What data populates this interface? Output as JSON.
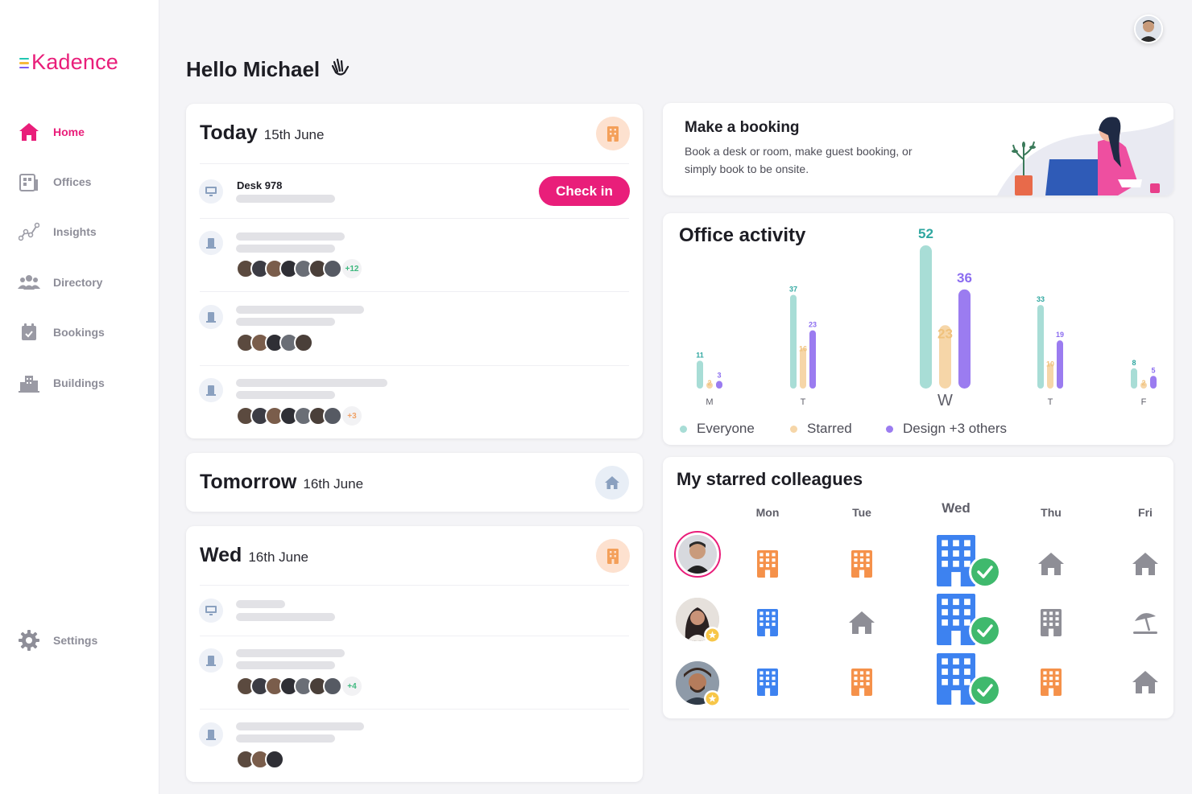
{
  "app": {
    "logo_text": "Kadence",
    "brand_color": "#e91e7a"
  },
  "sidebar": {
    "items": [
      {
        "label": "Home",
        "icon": "home-icon",
        "active": true
      },
      {
        "label": "Offices",
        "icon": "offices-icon",
        "active": false
      },
      {
        "label": "Insights",
        "icon": "insights-icon",
        "active": false
      },
      {
        "label": "Directory",
        "icon": "directory-icon",
        "active": false
      },
      {
        "label": "Bookings",
        "icon": "bookings-icon",
        "active": false
      },
      {
        "label": "Buildings",
        "icon": "buildings-icon",
        "active": false
      }
    ],
    "settings_label": "Settings"
  },
  "header": {
    "greeting": "Hello Michael",
    "greeting_icon": "waving-hand-icon"
  },
  "today": {
    "day": "Today",
    "date": "15th June",
    "location_icon": "office-building-icon",
    "desk_label": "Desk 978",
    "checkin_label": "Check in",
    "extra_counts": [
      "+12",
      "+3"
    ]
  },
  "tomorrow": {
    "day": "Tomorrow",
    "date": "16th June",
    "location_icon": "home-icon"
  },
  "wed": {
    "day": "Wed",
    "date": "16th June",
    "location_icon": "office-building-icon",
    "extra_counts": [
      "+4"
    ]
  },
  "booking": {
    "title": "Make a booking",
    "description": "Book a desk or room, make guest booking, or simply book to be onsite."
  },
  "office_activity": {
    "title": "Office activity",
    "chart_data": {
      "type": "bar",
      "categories": [
        "M",
        "T",
        "W",
        "T",
        "F"
      ],
      "series": [
        {
          "name": "Everyone",
          "values": [
            11,
            37,
            52,
            33,
            8
          ],
          "color": "#a8ddd6",
          "label_color": "#2fa7a0"
        },
        {
          "name": "Starred",
          "values": [
            2,
            16,
            23,
            10,
            2
          ],
          "color": "#f6d6a8",
          "label_color": "#f0c27d"
        },
        {
          "name": "Design +3 others",
          "values": [
            3,
            23,
            36,
            19,
            5
          ],
          "color": "#9b7cf0",
          "label_color": "#8b6cf0"
        }
      ],
      "highlight_category": "W"
    }
  },
  "colleagues": {
    "title": "My starred colleagues",
    "days": [
      "Mon",
      "Tue",
      "Wed",
      "Thu",
      "Fri"
    ],
    "rows": [
      {
        "cells": [
          "orange-office-icon",
          "orange-office-icon",
          "blue-office-checked-icon",
          "home-icon",
          "home-icon"
        ]
      },
      {
        "cells": [
          "blue-office-icon",
          "home-icon",
          "blue-office-checked-icon",
          "grey-office-icon",
          "beach-umbrella-icon"
        ]
      },
      {
        "cells": [
          "blue-office-icon",
          "orange-office-icon",
          "blue-office-checked-icon",
          "orange-office-icon",
          "home-icon"
        ]
      }
    ]
  }
}
